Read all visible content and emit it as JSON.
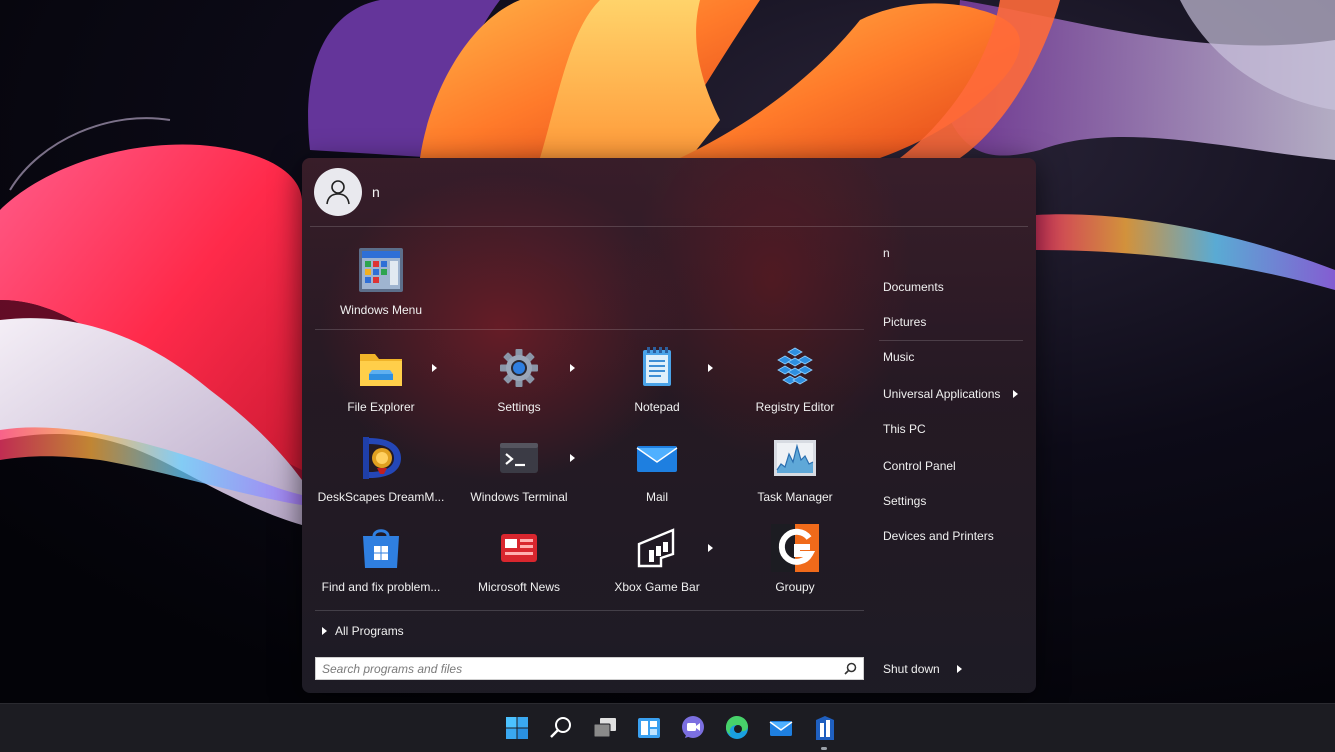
{
  "user": {
    "name": "n"
  },
  "pinned": {
    "top_item": {
      "label": "Windows Menu",
      "icon": "windows-menu-icon"
    }
  },
  "apps": [
    {
      "label": "File Explorer",
      "icon": "folder-icon",
      "has_submenu": true
    },
    {
      "label": "Settings",
      "icon": "gear-icon",
      "has_submenu": true
    },
    {
      "label": "Notepad",
      "icon": "notepad-icon",
      "has_submenu": true
    },
    {
      "label": "Registry Editor",
      "icon": "registry-icon",
      "has_submenu": false
    },
    {
      "label": "DeskScapes DreamM...",
      "icon": "deskscapes-icon",
      "has_submenu": false
    },
    {
      "label": "Windows Terminal",
      "icon": "terminal-icon",
      "has_submenu": true
    },
    {
      "label": "Mail",
      "icon": "mail-icon",
      "has_submenu": false
    },
    {
      "label": "Task Manager",
      "icon": "task-manager-icon",
      "has_submenu": false
    },
    {
      "label": "Find and fix problem...",
      "icon": "store-icon",
      "has_submenu": false
    },
    {
      "label": "Microsoft News",
      "icon": "news-icon",
      "has_submenu": false
    },
    {
      "label": "Xbox Game Bar",
      "icon": "xbox-game-bar-icon",
      "has_submenu": true
    },
    {
      "label": "Groupy",
      "icon": "groupy-icon",
      "has_submenu": false
    }
  ],
  "all_programs_label": "All Programs",
  "search": {
    "placeholder": "Search programs and files",
    "value": ""
  },
  "sidebar": {
    "items": [
      {
        "label": "n"
      },
      {
        "label": "Documents"
      },
      {
        "label": "Pictures"
      },
      {
        "label": "Music"
      },
      {
        "label": "Universal Applications",
        "has_submenu": true
      },
      {
        "label": "This PC"
      },
      {
        "label": "Control Panel"
      },
      {
        "label": "Settings"
      },
      {
        "label": "Devices and Printers"
      }
    ]
  },
  "shutdown_label": "Shut down",
  "taskbar": {
    "icons": [
      "start-icon",
      "search-icon",
      "task-view-icon",
      "widgets-icon",
      "teams-chat-icon",
      "edge-icon",
      "mail-icon",
      "start11-icon"
    ]
  },
  "colors": {
    "accent": "#2b7de9",
    "menu_bg": "#2a2330",
    "taskbar_bg": "#1c1c22"
  }
}
